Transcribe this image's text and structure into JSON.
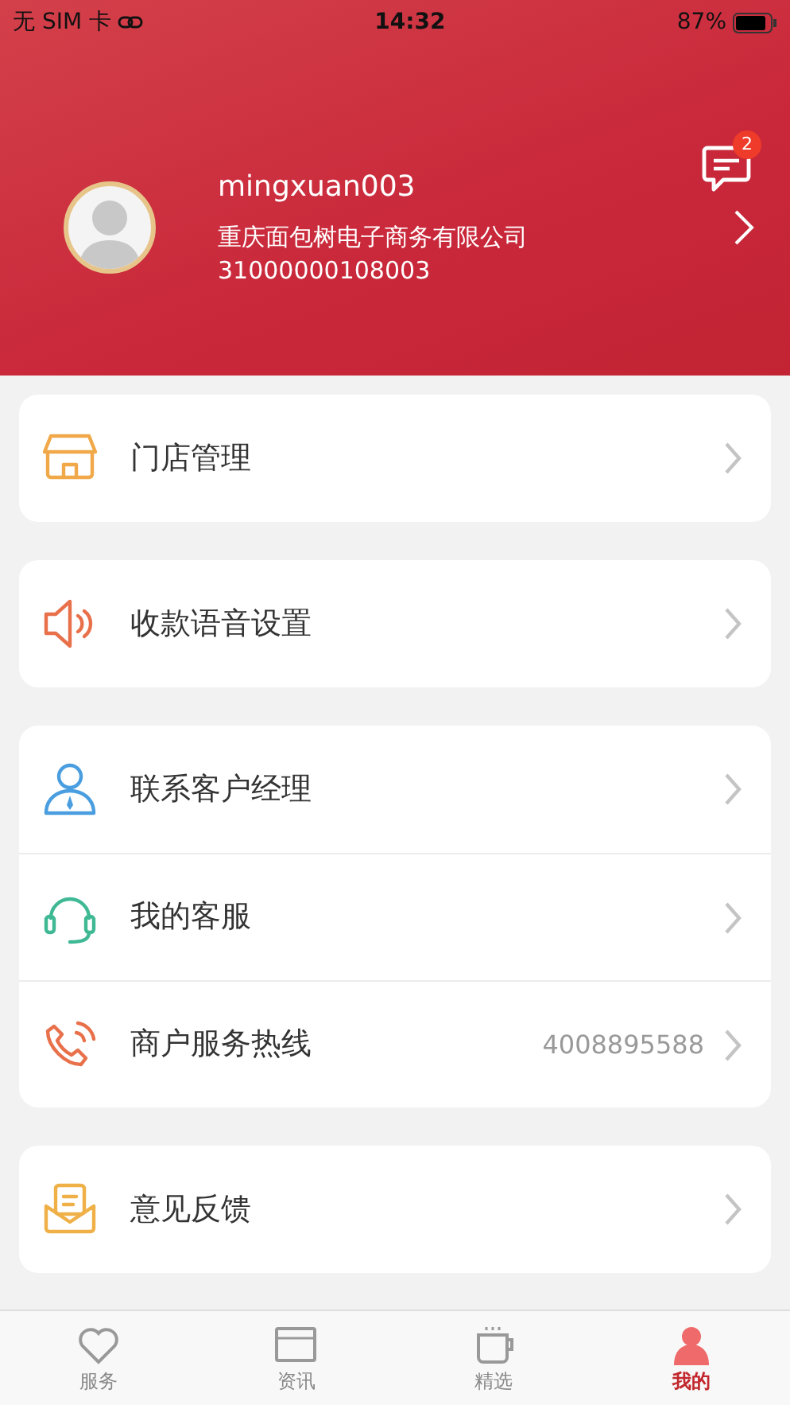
{
  "status_bar": {
    "carrier": "无 SIM 卡",
    "time": "14:32",
    "battery": "87%"
  },
  "profile": {
    "username": "mingxuan003",
    "company": "重庆面包树电子商务有限公司",
    "account": "31000000108003",
    "message_badge": "2"
  },
  "groups": [
    {
      "items": [
        {
          "kind": "store",
          "label": "门店管理"
        }
      ]
    },
    {
      "items": [
        {
          "kind": "speaker",
          "label": "收款语音设置"
        }
      ]
    },
    {
      "items": [
        {
          "kind": "manager",
          "label": "联系客户经理"
        },
        {
          "kind": "headset",
          "label": "我的客服"
        },
        {
          "kind": "phone",
          "label": "商户服务热线",
          "value": "4008895588"
        }
      ]
    },
    {
      "items": [
        {
          "kind": "feedback",
          "label": "意见反馈"
        }
      ]
    }
  ],
  "tabs": [
    {
      "kind": "heart",
      "label": "服务",
      "selected": false
    },
    {
      "kind": "card",
      "label": "资讯",
      "selected": false
    },
    {
      "kind": "cup",
      "label": "精选",
      "selected": false
    },
    {
      "kind": "person",
      "label": "我的",
      "selected": true
    }
  ]
}
